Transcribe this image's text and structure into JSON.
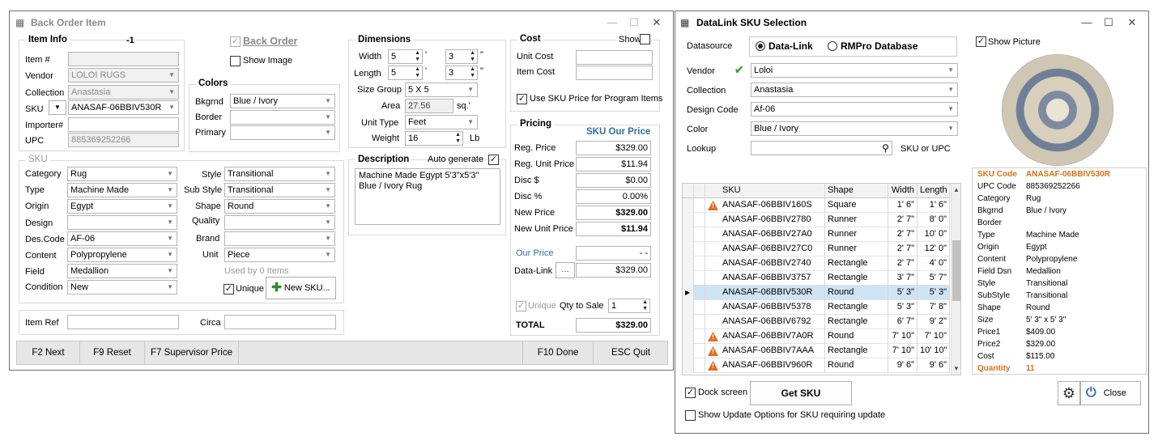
{
  "back_order": {
    "title": "Back Order Item",
    "item_info": {
      "title": "Item Info",
      "id": "-1",
      "item_no_label": "Item #",
      "item_no": "",
      "vendor_label": "Vendor",
      "vendor": "LOLOI RUGS",
      "collection_label": "Collection",
      "collection": "Anastasia",
      "sku_label": "SKU",
      "sku": "ANASAF-06BBIV530R",
      "importer_label": "Importer#",
      "importer": "",
      "upc_label": "UPC",
      "upc": "885369252266"
    },
    "back_order_label": "Back Order",
    "show_image_label": "Show Image",
    "colors": {
      "title": "Colors",
      "bkgrnd_label": "Bkgrnd",
      "bkgrnd": "Blue / Ivory",
      "border_label": "Border",
      "border": "",
      "primary_label": "Primary",
      "primary": ""
    },
    "dimensions": {
      "title": "Dimensions",
      "width_label": "Width",
      "width_ft": "5",
      "width_in": "3",
      "length_label": "Length",
      "length_ft": "5",
      "length_in": "3",
      "ft_mark": "'",
      "in_mark": "\"",
      "size_group_label": "Size Group",
      "size_group": "5 X 5",
      "area_label": "Area",
      "area": "27.56",
      "area_unit": "sq.'",
      "unit_type_label": "Unit Type",
      "unit_type": "Feet",
      "weight_label": "Weight",
      "weight": "16",
      "weight_unit": "Lb"
    },
    "description": {
      "title": "Description",
      "auto_generate_label": "Auto generate",
      "text": "Machine Made Egypt 5'3\"x5'3\" Blue / Ivory Rug"
    },
    "cost": {
      "title": "Cost",
      "show_label": "Show",
      "unit_cost_label": "Unit Cost",
      "unit_cost": "",
      "item_cost_label": "Item Cost",
      "item_cost": "",
      "use_sku_label": "Use SKU Price for Program Items"
    },
    "pricing": {
      "title": "Pricing",
      "sku_our_price_label": "SKU Our Price",
      "reg_price_label": "Reg. Price",
      "reg_price": "$329.00",
      "reg_unit_label": "Reg. Unit Price",
      "reg_unit": "$11.94",
      "disc_d_label": "Disc $",
      "disc_d": "$0.00",
      "disc_p_label": "Disc %",
      "disc_p": "0.00%",
      "new_price_label": "New Price",
      "new_price": "$329.00",
      "new_unit_label": "New Unit Price",
      "new_unit": "$11.94",
      "our_price_label": "Our Price",
      "our_price": "- -",
      "datalink_label": "Data-Link",
      "datalink_btn": "...",
      "datalink": "$329.00",
      "unique_label": "Unique",
      "qty_label": "Qty to Sale",
      "qty": "1",
      "total_label": "TOTAL",
      "total": "$329.00"
    },
    "sku": {
      "title": "SKU",
      "category_label": "Category",
      "category": "Rug",
      "type_label": "Type",
      "type": "Machine Made",
      "origin_label": "Origin",
      "origin": "Egypt",
      "design_label": "Design",
      "design": "",
      "descode_label": "Des.Code",
      "descode": "AF-06",
      "content_label": "Content",
      "content": "Polypropylene",
      "field_label": "Field",
      "field": "Medallion",
      "condition_label": "Condition",
      "condition": "New",
      "style_label": "Style",
      "style": "Transitional",
      "substyle_label": "Sub Style",
      "substyle": "Transitional",
      "shape_label": "Shape",
      "shape": "Round",
      "quality_label": "Quality",
      "quality": "",
      "brand_label": "Brand",
      "brand": "",
      "unit_label": "Unit",
      "unit": "Piece",
      "used_by": "Used by 0 Items",
      "unique_label": "Unique",
      "new_sku": "New SKU..."
    },
    "item_ref_label": "Item Ref",
    "item_ref": "",
    "circa_label": "Circa",
    "circa": "",
    "toolbar": {
      "next": "F2 Next",
      "reset": "F9 Reset",
      "supervisor": "F7 Supervisor Price",
      "done": "F10 Done",
      "quit": "ESC Quit"
    }
  },
  "datalink": {
    "title": "DataLink SKU Selection",
    "datasource_label": "Datasource",
    "opt_datalink": "Data-Link",
    "opt_rmpro": "RMPro Database",
    "vendor_label": "Vendor",
    "vendor": "Loloi",
    "collection_label": "Collection",
    "collection": "Anastasia",
    "design_code_label": "Design Code",
    "design_code": "Af-06",
    "color_label": "Color",
    "color": "Blue / Ivory",
    "lookup_label": "Lookup",
    "lookup": "",
    "lookup_hint": "SKU or UPC",
    "show_picture_label": "Show Picture",
    "columns": [
      "SKU",
      "Shape",
      "Width",
      "Length"
    ],
    "rows": [
      {
        "sku": "ANASAF-06BBIV160S",
        "shape": "Square",
        "width": "1' 6\"",
        "length": "1' 6\"",
        "warn": true
      },
      {
        "sku": "ANASAF-06BBIV2780",
        "shape": "Runner",
        "width": "2' 7\"",
        "length": "8' 0\"",
        "warn": false
      },
      {
        "sku": "ANASAF-06BBIV27A0",
        "shape": "Runner",
        "width": "2' 7\"",
        "length": "10' 0\"",
        "warn": false
      },
      {
        "sku": "ANASAF-06BBIV27C0",
        "shape": "Runner",
        "width": "2' 7\"",
        "length": "12' 0\"",
        "warn": false
      },
      {
        "sku": "ANASAF-06BBIV2740",
        "shape": "Rectangle",
        "width": "2' 7\"",
        "length": "4' 0\"",
        "warn": false
      },
      {
        "sku": "ANASAF-06BBIV3757",
        "shape": "Rectangle",
        "width": "3' 7\"",
        "length": "5' 7\"",
        "warn": false
      },
      {
        "sku": "ANASAF-06BBIV530R",
        "shape": "Round",
        "width": "5' 3\"",
        "length": "5' 3\"",
        "warn": false,
        "selected": true
      },
      {
        "sku": "ANASAF-06BBIV5378",
        "shape": "Rectangle",
        "width": "5' 3\"",
        "length": "7' 8\"",
        "warn": false
      },
      {
        "sku": "ANASAF-06BBIV6792",
        "shape": "Rectangle",
        "width": "6' 7\"",
        "length": "9' 2\"",
        "warn": false
      },
      {
        "sku": "ANASAF-06BBIV7A0R",
        "shape": "Round",
        "width": "7' 10\"",
        "length": "7' 10\"",
        "warn": true
      },
      {
        "sku": "ANASAF-06BBIV7AAA",
        "shape": "Rectangle",
        "width": "7' 10\"",
        "length": "10' 10\"",
        "warn": true
      },
      {
        "sku": "ANASAF-06BBIV960R",
        "shape": "Round",
        "width": "9' 6\"",
        "length": "9' 6\"",
        "warn": true
      }
    ],
    "details": [
      {
        "label": "SKU Code",
        "value": "ANASAF-06BBIV530R"
      },
      {
        "label": "UPC Code",
        "value": "885369252266"
      },
      {
        "label": "Category",
        "value": "Rug"
      },
      {
        "label": "Bkgrnd",
        "value": "Blue / Ivory"
      },
      {
        "label": "Border",
        "value": ""
      },
      {
        "label": "Type",
        "value": "Machine Made"
      },
      {
        "label": "Origin",
        "value": "Egypt"
      },
      {
        "label": "Content",
        "value": "Polypropylene"
      },
      {
        "label": "Field Dsn",
        "value": "Medallion"
      },
      {
        "label": "Style",
        "value": "Transitional"
      },
      {
        "label": "SubStyle",
        "value": "Transitional"
      },
      {
        "label": "Shape",
        "value": "Round"
      },
      {
        "label": "Size",
        "value": "5' 3\" x 5' 3\""
      },
      {
        "label": "Price1",
        "value": "$409.00"
      },
      {
        "label": "Price2",
        "value": "$329.00"
      },
      {
        "label": "Cost",
        "value": "$115.00"
      },
      {
        "label": "Quantity",
        "value": "11"
      }
    ],
    "dock_label": "Dock screen",
    "get_sku": "Get SKU",
    "close": "Close",
    "show_update_label": "Show Update Options for SKU requiring update"
  },
  "colors": {
    "accent_blue": "#2f6da8",
    "orange": "#d86f1a",
    "selected_row": "#cfe4f4"
  }
}
